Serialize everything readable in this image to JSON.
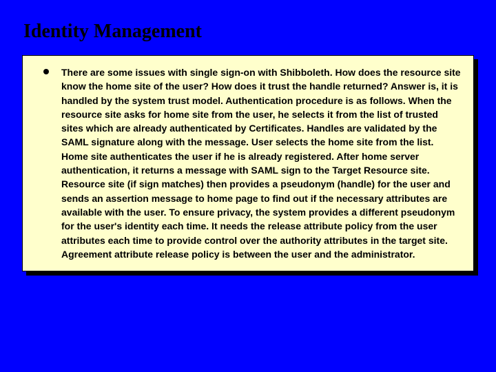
{
  "slide": {
    "title": "Identity Management",
    "body": "There are some issues with single sign-on with Shibboleth. How does the resource site know the home site of the user?  How does it trust the handle returned? Answer is, it is handled by the system trust model. Authentication procedure is as follows. When the resource site asks for home site from the user, he selects it from the list of trusted sites which are already authenticated by Certificates. Handles are validated by the SAML signature along with the message. User selects the home site from the list. Home site authenticates the user if he is already registered. After home server authentication, it returns a message with SAML sign to the Target Resource site. Resource site (if sign matches) then provides a pseudonym (handle) for the user and sends an assertion message to home page to find out if the necessary attributes are available with the user. To ensure privacy, the system provides a different pseudonym for the user's identity each time. It needs the release attribute policy from the user attributes each time to provide control over the authority attributes in the target site. Agreement attribute release policy is between the user and the administrator."
  }
}
